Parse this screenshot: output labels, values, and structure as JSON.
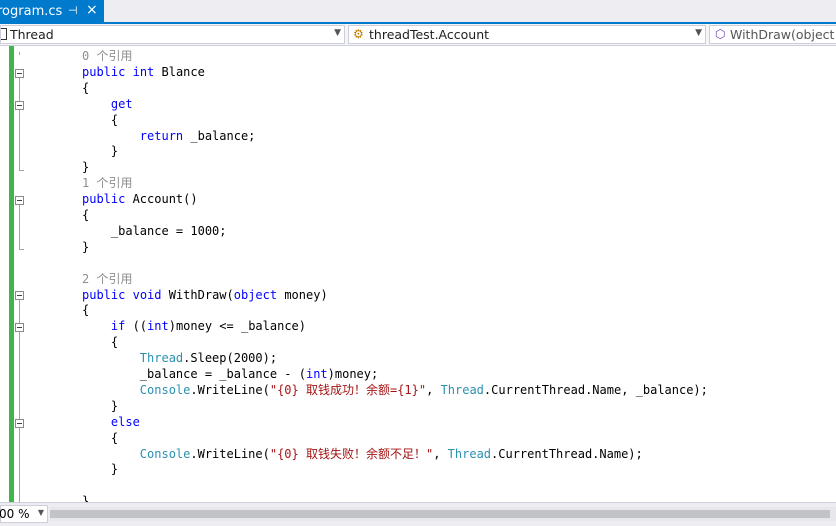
{
  "tab": {
    "title": "rogram.cs",
    "pin_glyph": "⊣",
    "close_glyph": "×"
  },
  "nav": {
    "project": "Thread",
    "type": "threadTest.Account",
    "member": "WithDraw(object m"
  },
  "editor": {
    "lines": [
      {
        "parts": [
          {
            "t": "0 个引用",
            "c": "lens"
          }
        ]
      },
      {
        "parts": [
          {
            "t": "public",
            "c": "kw"
          },
          {
            "t": " "
          },
          {
            "t": "int",
            "c": "kw"
          },
          {
            "t": " Blance"
          }
        ]
      },
      {
        "parts": [
          {
            "t": "{"
          }
        ]
      },
      {
        "parts": [
          {
            "t": "    "
          },
          {
            "t": "get",
            "c": "kw"
          }
        ]
      },
      {
        "parts": [
          {
            "t": "    {"
          }
        ]
      },
      {
        "parts": [
          {
            "t": "        "
          },
          {
            "t": "return",
            "c": "kw"
          },
          {
            "t": " _balance;"
          }
        ]
      },
      {
        "parts": [
          {
            "t": "    }"
          }
        ]
      },
      {
        "parts": [
          {
            "t": "}"
          }
        ]
      },
      {
        "parts": [
          {
            "t": "1 个引用",
            "c": "lens"
          }
        ]
      },
      {
        "parts": [
          {
            "t": "public",
            "c": "kw"
          },
          {
            "t": " Account()"
          }
        ]
      },
      {
        "parts": [
          {
            "t": "{"
          }
        ]
      },
      {
        "parts": [
          {
            "t": "    _balance = 1000;"
          }
        ]
      },
      {
        "parts": [
          {
            "t": "}"
          }
        ]
      },
      {
        "parts": [
          {
            "t": ""
          }
        ]
      },
      {
        "parts": [
          {
            "t": "2 个引用",
            "c": "lens"
          }
        ]
      },
      {
        "parts": [
          {
            "t": "public",
            "c": "kw"
          },
          {
            "t": " "
          },
          {
            "t": "void",
            "c": "kw"
          },
          {
            "t": " WithDraw("
          },
          {
            "t": "object",
            "c": "kw"
          },
          {
            "t": " money)"
          }
        ]
      },
      {
        "parts": [
          {
            "t": "{"
          }
        ]
      },
      {
        "parts": [
          {
            "t": "    "
          },
          {
            "t": "if",
            "c": "kw"
          },
          {
            "t": " (("
          },
          {
            "t": "int",
            "c": "kw"
          },
          {
            "t": ")money <= _balance)"
          }
        ]
      },
      {
        "parts": [
          {
            "t": "    {"
          }
        ]
      },
      {
        "parts": [
          {
            "t": "        "
          },
          {
            "t": "Thread",
            "c": "ty"
          },
          {
            "t": ".Sleep(2000);"
          }
        ]
      },
      {
        "parts": [
          {
            "t": "        _balance = _balance - ("
          },
          {
            "t": "int",
            "c": "kw"
          },
          {
            "t": ")money;"
          }
        ]
      },
      {
        "parts": [
          {
            "t": "        "
          },
          {
            "t": "Console",
            "c": "ty"
          },
          {
            "t": ".WriteLine("
          },
          {
            "t": "\"{0} 取钱成功！余额={1}\"",
            "c": "st"
          },
          {
            "t": ", "
          },
          {
            "t": "Thread",
            "c": "ty"
          },
          {
            "t": ".CurrentThread.Name, _balance);"
          }
        ]
      },
      {
        "parts": [
          {
            "t": "    }"
          }
        ]
      },
      {
        "parts": [
          {
            "t": "    "
          },
          {
            "t": "else",
            "c": "kw"
          }
        ]
      },
      {
        "parts": [
          {
            "t": "    {"
          }
        ]
      },
      {
        "parts": [
          {
            "t": "        "
          },
          {
            "t": "Console",
            "c": "ty"
          },
          {
            "t": ".WriteLine("
          },
          {
            "t": "\"{0} 取钱失败！余额不足！\"",
            "c": "st"
          },
          {
            "t": ", "
          },
          {
            "t": "Thread",
            "c": "ty"
          },
          {
            "t": ".CurrentThread.Name);"
          }
        ]
      },
      {
        "parts": [
          {
            "t": "    }"
          }
        ]
      },
      {
        "parts": [
          {
            "t": ""
          }
        ]
      },
      {
        "parts": [
          {
            "t": "}"
          }
        ]
      }
    ]
  },
  "status": {
    "zoom": "00 %"
  },
  "colors": {
    "accent": "#007acc",
    "keyword": "#0000ff",
    "type": "#2b91af",
    "string": "#a31515",
    "codelens": "#8e8e8e",
    "changebar": "#3fb54a"
  }
}
